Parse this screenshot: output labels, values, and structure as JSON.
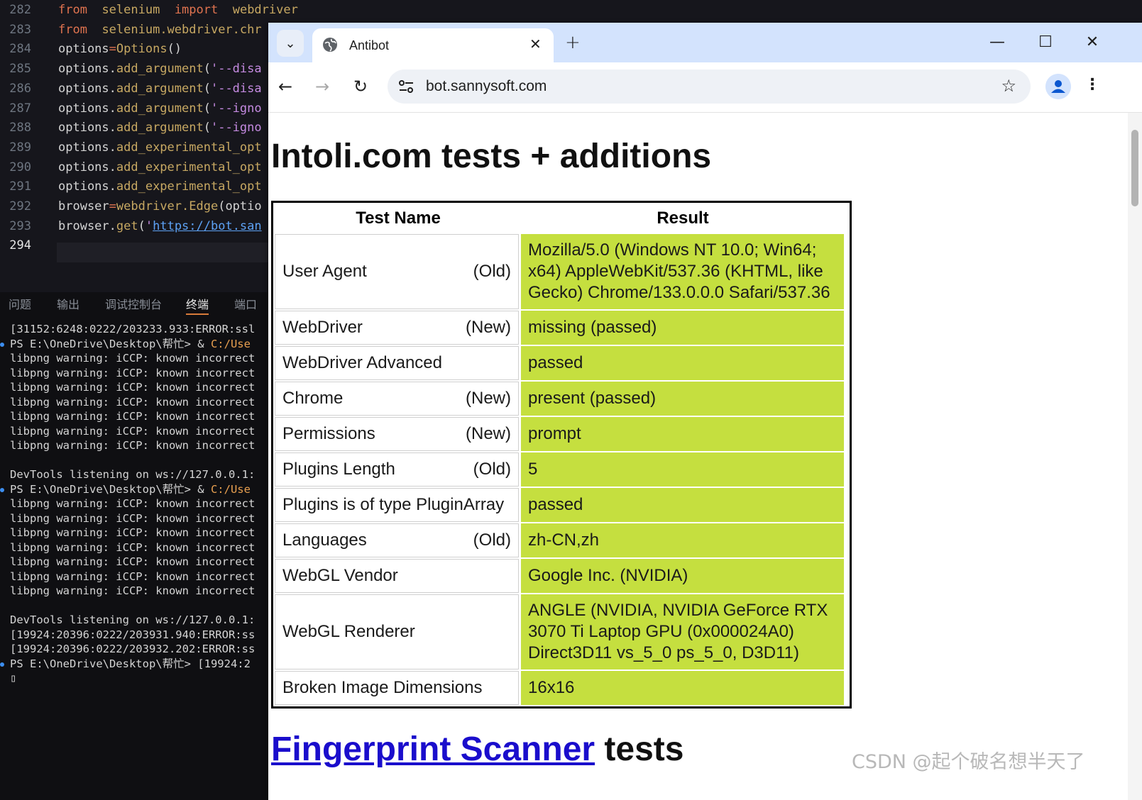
{
  "editor": {
    "lines": [
      {
        "num": "282",
        "parts": [
          [
            "kw",
            "from"
          ],
          [
            "t",
            "  "
          ],
          [
            "fn",
            "selenium"
          ],
          [
            "t",
            "  "
          ],
          [
            "kw",
            "import"
          ],
          [
            "t",
            "  "
          ],
          [
            "fn",
            "webdriver"
          ]
        ]
      },
      {
        "num": "283",
        "parts": [
          [
            "kw",
            "from"
          ],
          [
            "t",
            "  "
          ],
          [
            "fn",
            "selenium.webdriver.chr"
          ]
        ]
      },
      {
        "num": "284",
        "parts": [
          [
            "t",
            "options"
          ],
          [
            "kw",
            "="
          ],
          [
            "fn",
            "Options"
          ],
          [
            "t",
            "()"
          ]
        ]
      },
      {
        "num": "285",
        "parts": [
          [
            "t",
            "options."
          ],
          [
            "fn",
            "add_argument"
          ],
          [
            "t",
            "("
          ],
          [
            "str",
            "'--disa"
          ]
        ]
      },
      {
        "num": "286",
        "parts": [
          [
            "t",
            "options."
          ],
          [
            "fn",
            "add_argument"
          ],
          [
            "t",
            "("
          ],
          [
            "str",
            "'--disa"
          ]
        ]
      },
      {
        "num": "287",
        "parts": [
          [
            "t",
            "options."
          ],
          [
            "fn",
            "add_argument"
          ],
          [
            "t",
            "("
          ],
          [
            "str",
            "'--igno"
          ]
        ]
      },
      {
        "num": "288",
        "parts": [
          [
            "t",
            "options."
          ],
          [
            "fn",
            "add_argument"
          ],
          [
            "t",
            "("
          ],
          [
            "str",
            "'--igno"
          ]
        ]
      },
      {
        "num": "289",
        "parts": [
          [
            "t",
            "options."
          ],
          [
            "fn",
            "add_experimental_opt"
          ]
        ]
      },
      {
        "num": "290",
        "parts": [
          [
            "t",
            "options."
          ],
          [
            "fn",
            "add_experimental_opt"
          ]
        ]
      },
      {
        "num": "291",
        "parts": [
          [
            "t",
            "options."
          ],
          [
            "fn",
            "add_experimental_opt"
          ]
        ]
      },
      {
        "num": "292",
        "parts": [
          [
            "t",
            "browser"
          ],
          [
            "kw",
            "="
          ],
          [
            "fn",
            "webdriver.Edge"
          ],
          [
            "t",
            "(optio"
          ]
        ]
      },
      {
        "num": "293",
        "parts": [
          [
            "t",
            "browser."
          ],
          [
            "fn",
            "get"
          ],
          [
            "t",
            "("
          ],
          [
            "str",
            "'"
          ],
          [
            "url",
            "https://bot.san"
          ]
        ]
      },
      {
        "num": "294",
        "parts": []
      }
    ]
  },
  "panel": {
    "tabs": [
      "问题",
      "输出",
      "调试控制台",
      "终端",
      "端口"
    ],
    "active_tab": "终端",
    "terminal_lines": [
      {
        "text": "[31152:6248:0222/203233.933:ERROR:ssl"
      },
      {
        "text": "PS E:\\OneDrive\\Desktop\\帮忙> & ",
        "path": "C:/Use",
        "dot": true
      },
      {
        "text": "libpng warning: iCCP: known incorrect"
      },
      {
        "text": "libpng warning: iCCP: known incorrect"
      },
      {
        "text": "libpng warning: iCCP: known incorrect"
      },
      {
        "text": "libpng warning: iCCP: known incorrect"
      },
      {
        "text": "libpng warning: iCCP: known incorrect"
      },
      {
        "text": "libpng warning: iCCP: known incorrect"
      },
      {
        "text": "libpng warning: iCCP: known incorrect"
      },
      {
        "text": ""
      },
      {
        "text": "DevTools listening on ws://127.0.0.1:"
      },
      {
        "text": "PS E:\\OneDrive\\Desktop\\帮忙> & ",
        "path": "C:/Use",
        "dot": true
      },
      {
        "text": "libpng warning: iCCP: known incorrect"
      },
      {
        "text": "libpng warning: iCCP: known incorrect"
      },
      {
        "text": "libpng warning: iCCP: known incorrect"
      },
      {
        "text": "libpng warning: iCCP: known incorrect"
      },
      {
        "text": "libpng warning: iCCP: known incorrect"
      },
      {
        "text": "libpng warning: iCCP: known incorrect"
      },
      {
        "text": "libpng warning: iCCP: known incorrect"
      },
      {
        "text": ""
      },
      {
        "text": "DevTools listening on ws://127.0.0.1:"
      },
      {
        "text": "[19924:20396:0222/203931.940:ERROR:ss"
      },
      {
        "text": "[19924:20396:0222/203932.202:ERROR:ss"
      },
      {
        "text": "PS E:\\OneDrive\\Desktop\\帮忙> [19924:2",
        "dot": true
      },
      {
        "text": "▯"
      }
    ]
  },
  "browser": {
    "tab_title": "Antibot",
    "tab_close": "✕",
    "new_tab": "+",
    "url": "bot.sannysoft.com",
    "controls": {
      "minimize": "—",
      "maximize": "☐",
      "close": "✕"
    },
    "nav": {
      "back": "←",
      "forward": "→",
      "reload": "↻"
    },
    "star": "☆",
    "menu": "⋮"
  },
  "page": {
    "title": "Intoli.com tests + additions",
    "table": {
      "headers": [
        "Test Name",
        "Result"
      ],
      "rows": [
        {
          "name": "User Agent",
          "tag": "(Old)",
          "result": "Mozilla/5.0 (Windows NT 10.0; Win64; x64) AppleWebKit/537.36 (KHTML, like Gecko) Chrome/133.0.0.0 Safari/537.36"
        },
        {
          "name": "WebDriver",
          "tag": "(New)",
          "result": "missing (passed)"
        },
        {
          "name": "WebDriver Advanced",
          "tag": "",
          "result": "passed"
        },
        {
          "name": "Chrome",
          "tag": "(New)",
          "result": "present (passed)"
        },
        {
          "name": "Permissions",
          "tag": "(New)",
          "result": "prompt"
        },
        {
          "name": "Plugins Length",
          "tag": "(Old)",
          "result": "5"
        },
        {
          "name": "Plugins is of type PluginArray",
          "tag": "",
          "result": "passed"
        },
        {
          "name": "Languages",
          "tag": "(Old)",
          "result": "zh-CN,zh"
        },
        {
          "name": "WebGL Vendor",
          "tag": "",
          "result": "Google Inc. (NVIDIA)"
        },
        {
          "name": "WebGL Renderer",
          "tag": "",
          "result": "ANGLE (NVIDIA, NVIDIA GeForce RTX 3070 Ti Laptop GPU (0x000024A0) Direct3D11 vs_5_0 ps_5_0, D3D11)"
        },
        {
          "name": "Broken Image Dimensions",
          "tag": "",
          "result": "16x16"
        }
      ]
    },
    "section2_link": "Fingerprint Scanner",
    "section2_rest": " tests"
  },
  "watermark": "CSDN @起个破名想半天了",
  "colors": {
    "pass_green": "#c5df3f",
    "link_blue": "#1a0dcc",
    "titlebar": "#d3e3fd"
  }
}
